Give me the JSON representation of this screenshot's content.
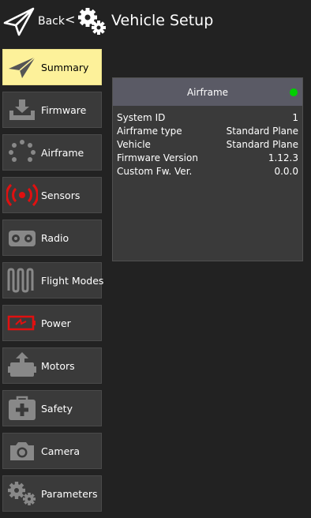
{
  "header": {
    "back_label": "Back",
    "separator": "<",
    "title": "Vehicle Setup"
  },
  "sidebar": {
    "items": [
      {
        "label": "Summary",
        "icon": "paper-plane-icon",
        "active": true
      },
      {
        "label": "Firmware",
        "icon": "download-icon",
        "active": false
      },
      {
        "label": "Airframe",
        "icon": "airframe-icon",
        "active": false
      },
      {
        "label": "Sensors",
        "icon": "sensors-icon",
        "active": false
      },
      {
        "label": "Radio",
        "icon": "radio-icon",
        "active": false
      },
      {
        "label": "Flight Modes",
        "icon": "wave-icon",
        "active": false
      },
      {
        "label": "Power",
        "icon": "battery-icon",
        "active": false
      },
      {
        "label": "Motors",
        "icon": "motor-icon",
        "active": false
      },
      {
        "label": "Safety",
        "icon": "first-aid-icon",
        "active": false
      },
      {
        "label": "Camera",
        "icon": "camera-icon",
        "active": false
      },
      {
        "label": "Parameters",
        "icon": "gears-icon",
        "active": false
      }
    ]
  },
  "airframe_card": {
    "title": "Airframe",
    "status_color": "#00d000",
    "rows": [
      {
        "label": "System ID",
        "value": "1"
      },
      {
        "label": "Airframe type",
        "value": "Standard Plane"
      },
      {
        "label": "Vehicle",
        "value": "Standard Plane"
      },
      {
        "label": "Firmware Version",
        "value": "1.12.3"
      },
      {
        "label": "Custom Fw. Ver.",
        "value": "0.0.0"
      }
    ]
  },
  "colors": {
    "active_bg": "#fdf19a",
    "item_bg": "#3a3a3a",
    "sensor_red": "#e01010",
    "power_red": "#e01010"
  }
}
